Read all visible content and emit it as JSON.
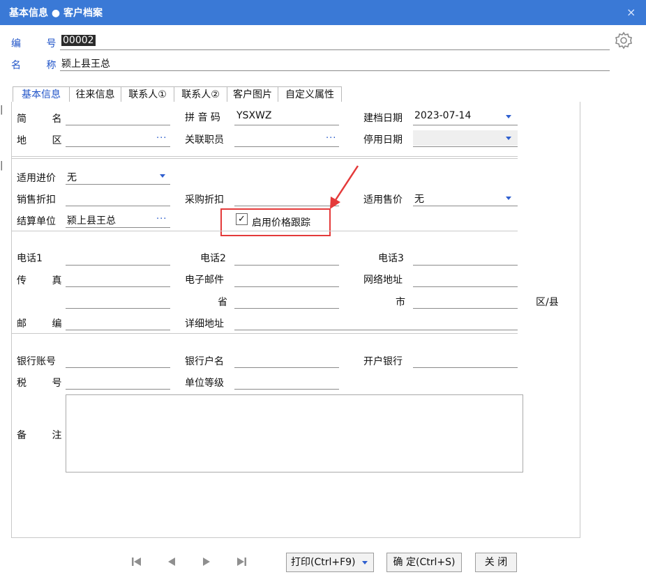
{
  "window": {
    "title": "基本信息 ● 客户档案",
    "close_glyph": "×"
  },
  "header": {
    "code_label": "编  号",
    "code_value": "00002",
    "name_label": "名  称",
    "name_value": "颍上县王总"
  },
  "tabs": [
    "基本信息",
    "往来信息",
    "联系人①",
    "联系人②",
    "客户图片",
    "自定义属性"
  ],
  "form": {
    "short_name_label": "简  名",
    "pinyin_label": "拼 音 码",
    "pinyin_value": "YSXWZ",
    "created_date_label": "建档日期",
    "created_date_value": "2023-07-14",
    "region_label": "地  区",
    "staff_label": "关联职员",
    "disabled_date_label": "停用日期",
    "purchase_price_label": "适用进价",
    "purchase_price_value": "无",
    "sales_discount_label": "销售折扣",
    "purchase_discount_label": "采购折扣",
    "sale_price_label": "适用售价",
    "sale_price_value": "无",
    "settle_unit_label": "结算单位",
    "settle_unit_value": "颍上县王总",
    "price_track_label": "启用价格跟踪",
    "price_track_checked": "✓",
    "phone1_label": "电话1",
    "phone2_label": "电话2",
    "phone3_label": "电话3",
    "fax_label": "传  真",
    "email_label": "电子邮件",
    "web_label": "网络地址",
    "province_label": "省",
    "city_label": "市",
    "district_label": "区/县",
    "zip_label": "邮  编",
    "address_label": "详细地址",
    "bank_account_label": "银行账号",
    "bank_name_label": "银行户名",
    "bank_label": "开户银行",
    "tax_label": "税  号",
    "level_label": "单位等级",
    "memo_label": "备  注",
    "dots": "···"
  },
  "footer": {
    "print_label": "打印(Ctrl+F9)",
    "ok_label": "确 定(Ctrl+S)",
    "close_label": "关 闭"
  },
  "colors": {
    "titlebar": "#3a79d6",
    "accent": "#1f53c8",
    "highlight": "#e43a3a"
  }
}
